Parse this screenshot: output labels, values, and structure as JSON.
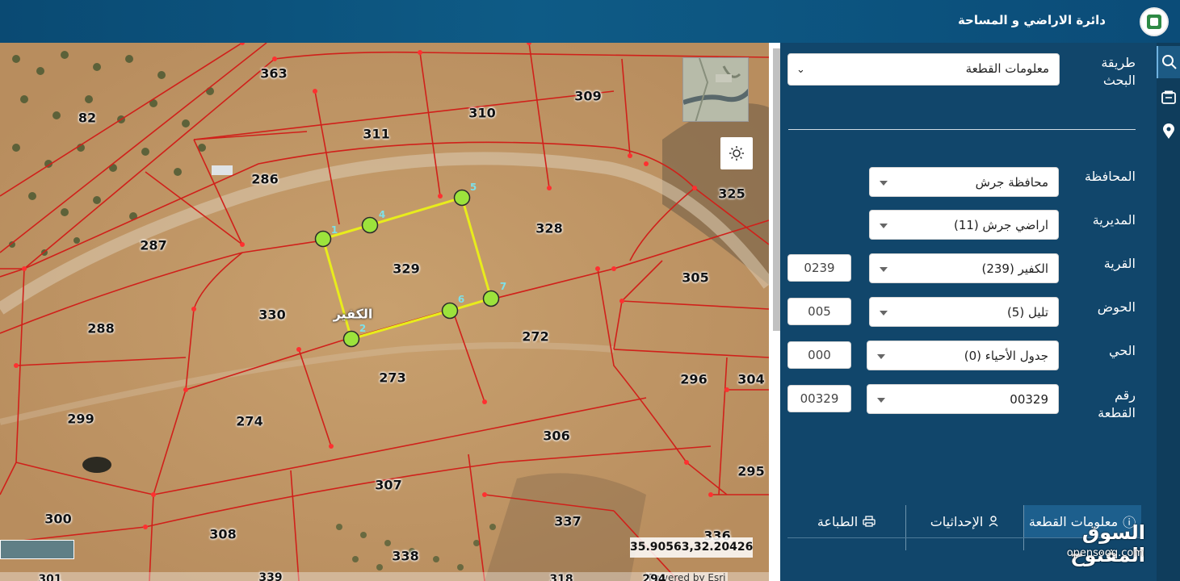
{
  "header": {
    "title": "دائرة الاراضي و المساحة"
  },
  "map": {
    "parcels": [
      "363",
      "82",
      "311",
      "310",
      "309",
      "286",
      "325",
      "328",
      "287",
      "329",
      "305",
      "330",
      "288",
      "272",
      "273",
      "296",
      "304",
      "299",
      "274",
      "306",
      "295",
      "307",
      "300",
      "308",
      "337",
      "336",
      "338",
      "301",
      "339",
      "318",
      "294"
    ],
    "vertices": [
      "1",
      "2",
      "4",
      "5",
      "6",
      "7"
    ],
    "village_label": "الكفير",
    "coordinates": "35.90563,32.20426",
    "attribution": "Powered by Esri",
    "minimap_text": "Kamtoops"
  },
  "panel": {
    "search_method_label": "طريقة البحث",
    "search_method_value": "معلومات القطعة",
    "fields": {
      "governorate": {
        "label": "المحافظة",
        "value": "محافظة جرش"
      },
      "directorate": {
        "label": "المديرية",
        "value": "اراضي جرش (11)"
      },
      "village": {
        "label": "القرية",
        "value": "الكفير (239)",
        "code": "0239"
      },
      "basin": {
        "label": "الحوض",
        "value": "تليل (5)",
        "code": "005"
      },
      "district": {
        "label": "الحي",
        "value": "جدول الأحياء (0)",
        "code": "000"
      },
      "parcel": {
        "label": "رقم القطعة",
        "value": "00329",
        "code": "00329"
      }
    },
    "tabs": [
      {
        "label": "معلومات القطعة",
        "icon": "info-icon"
      },
      {
        "label": "الإحداثيات",
        "icon": "person-pin-icon"
      },
      {
        "label": "الطباعة",
        "icon": "printer-icon"
      }
    ]
  },
  "rail": {
    "icons": [
      "search-icon",
      "map-icon",
      "location-pin-icon"
    ]
  },
  "watermark": {
    "arabic": "السوق المفتوح",
    "latin": "opensooq.com"
  }
}
